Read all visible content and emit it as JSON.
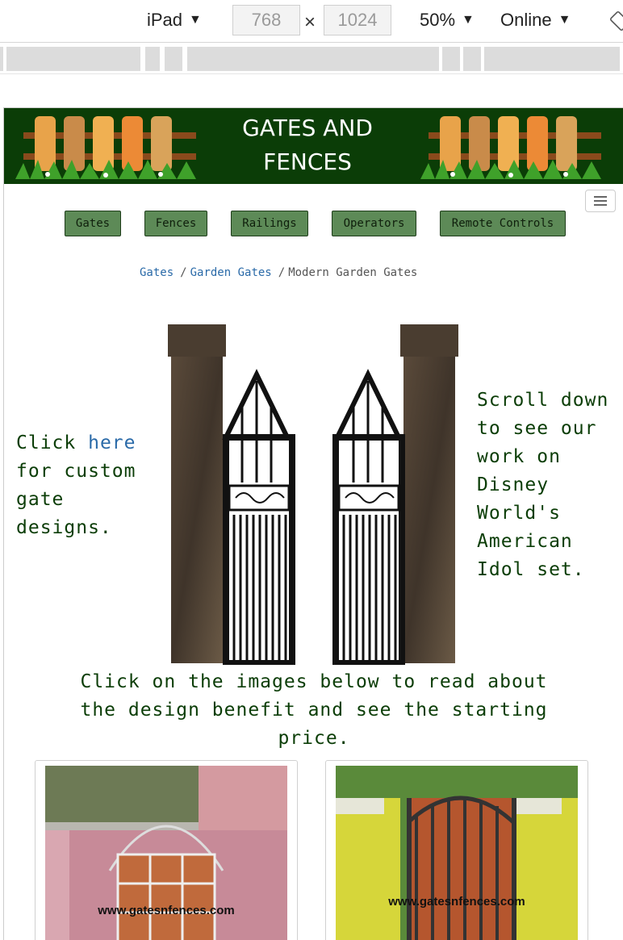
{
  "devtools": {
    "device": "iPad",
    "width_value": "768",
    "height_value": "1024",
    "zoom": "50%",
    "network": "Online"
  },
  "site": {
    "title_line1": "GATES AND",
    "title_line2": "FENCES",
    "nav": [
      "Gates",
      "Fences",
      "Railings",
      "Operators",
      "Remote Controls"
    ]
  },
  "breadcrumb": {
    "items": [
      "Gates",
      "Garden Gates"
    ],
    "current": "Modern Garden Gates"
  },
  "left_note": {
    "prefix": "Click ",
    "link": "here",
    "lines": [
      "for custom",
      "gate",
      "designs."
    ]
  },
  "right_note": {
    "lines": [
      "Scroll down",
      "to see our",
      "work on",
      "Disney",
      "World's",
      "American",
      "Idol set."
    ]
  },
  "intro": {
    "lines": [
      "Click on the images below to read about",
      "the design benefit and see the starting",
      "price."
    ]
  },
  "cards": [
    {
      "watermark": "www.gatesnfences.com"
    },
    {
      "watermark": "www.gatesnfences.com"
    }
  ]
}
